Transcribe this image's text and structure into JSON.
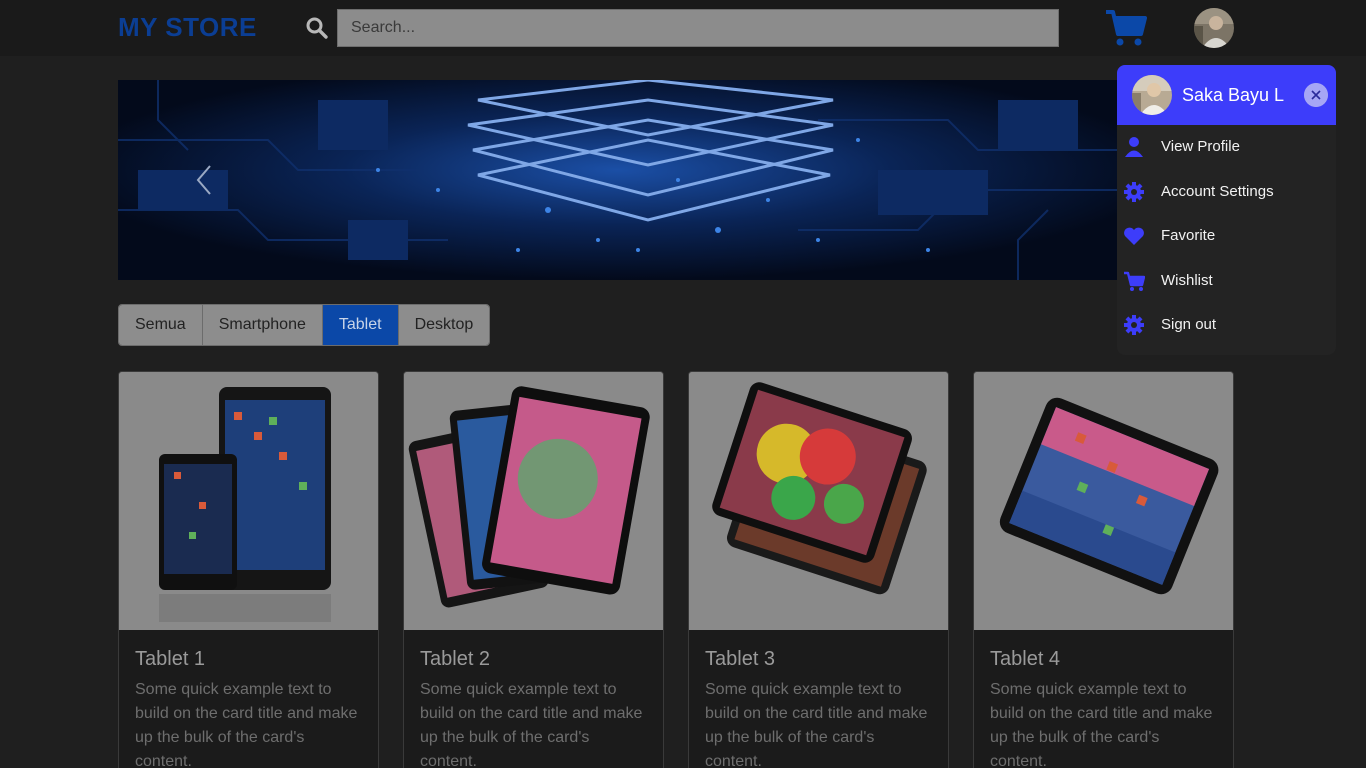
{
  "navbar": {
    "brand": "MY STORE",
    "search": {
      "placeholder": "Search...",
      "value": ""
    },
    "icons": {
      "search": "search-icon",
      "cart": "cart-icon",
      "avatar": "user-avatar"
    }
  },
  "hero": {
    "prev_icon": "chevron-left-icon"
  },
  "categories": {
    "tabs": [
      "Semua",
      "Smartphone",
      "Tablet",
      "Desktop"
    ],
    "active": "Tablet"
  },
  "products": [
    {
      "title": "Tablet 1",
      "text": "Some quick example text to build on the card title and make up the bulk of the card's content."
    },
    {
      "title": "Tablet 2",
      "text": "Some quick example text to build on the card title and make up the bulk of the card's content."
    },
    {
      "title": "Tablet 3",
      "text": "Some quick example text to build on the card title and make up the bulk of the card's content."
    },
    {
      "title": "Tablet 4",
      "text": "Some quick example text to build on the card title and make up the bulk of the card's content."
    }
  ],
  "user_menu": {
    "name": "Saka Bayu L",
    "close_icon": "close-icon",
    "items": [
      {
        "label": "View Profile",
        "icon": "user-icon"
      },
      {
        "label": "Account Settings",
        "icon": "gear-icon"
      },
      {
        "label": "Favorite",
        "icon": "heart-icon"
      },
      {
        "label": "Wishlist",
        "icon": "cart-icon"
      },
      {
        "label": "Sign out",
        "icon": "gear-icon"
      }
    ]
  },
  "colors": {
    "brand": "#0b3e94",
    "accent": "#3d3dfa",
    "active_tab": "#0b48a8",
    "background": "#1f1f1f"
  }
}
